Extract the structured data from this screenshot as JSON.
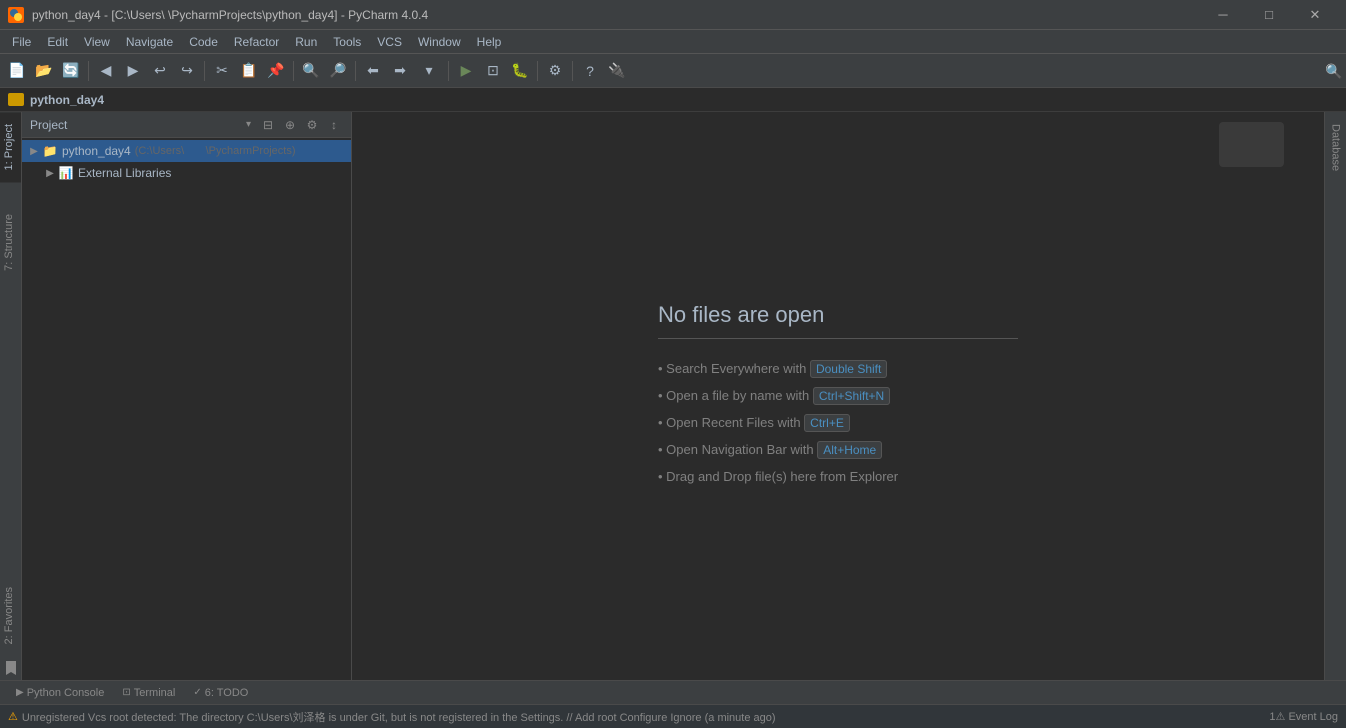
{
  "titleBar": {
    "icon": "🐍",
    "title": "python_day4 - [C:\\Users\\       \\PycharmProjects\\python_day4] - PyCharm 4.0.4",
    "minimize": "─",
    "maximize": "□",
    "close": "✕"
  },
  "menuBar": {
    "items": [
      "File",
      "Edit",
      "View",
      "Navigate",
      "Code",
      "Refactor",
      "Run",
      "Tools",
      "VCS",
      "Window",
      "Help"
    ]
  },
  "breadcrumb": {
    "text": "python_day4"
  },
  "projectPanel": {
    "title": "Project",
    "rootItem": {
      "name": "python_day4",
      "path": "(C:\\Users\\       \\PycharmProjects)"
    },
    "externalLibraries": "External Libraries"
  },
  "editorArea": {
    "noFilesTitle": "No files are open",
    "hints": [
      {
        "text": "Search Everywhere with ",
        "shortcut": "Double Shift"
      },
      {
        "text": "Open a file by name with ",
        "shortcut": "Ctrl+Shift+N"
      },
      {
        "text": "Open Recent Files with ",
        "shortcut": "Ctrl+E"
      },
      {
        "text": "Open Navigation Bar with ",
        "shortcut": "Alt+Home"
      },
      {
        "text": "Drag and Drop file(s) here from Explorer",
        "shortcut": ""
      }
    ]
  },
  "rightSidebar": {
    "label": "Database"
  },
  "leftSidebar": {
    "tabs": [
      "1: Project",
      "2: Favorites",
      "7: Structure"
    ]
  },
  "bottomToolbar": {
    "tabs": [
      "Python Console",
      "Terminal",
      "6: TODO"
    ]
  },
  "statusBar": {
    "text": "Unregistered Vcs root detected: The directory C:\\Users\\刘泽格 is under Git, but is not registered in the Settings. // Add root  Configure  Ignore (a minute ago)",
    "eventLog": "1⚠ Event Log"
  }
}
